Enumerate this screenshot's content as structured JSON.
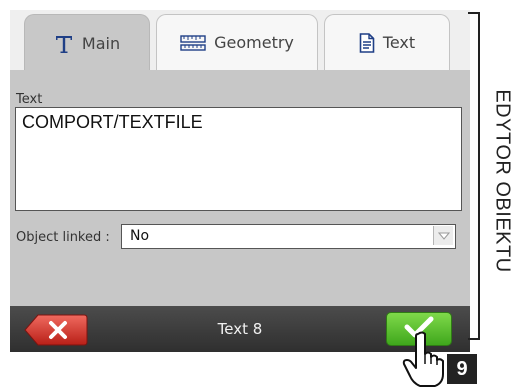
{
  "tabs": [
    {
      "label": "Main",
      "icon": "text-t-icon",
      "active": true
    },
    {
      "label": "Geometry",
      "icon": "ruler-icon",
      "active": false
    },
    {
      "label": "Text",
      "icon": "document-icon",
      "active": false
    }
  ],
  "text_field": {
    "label": "Text",
    "value": "COMPORT/TEXTFILE"
  },
  "object_linked": {
    "label": "Object linked :",
    "value": "No"
  },
  "footer": {
    "title": "Text 8",
    "cancel_icon": "close-icon",
    "ok_icon": "checkmark-icon"
  },
  "side_title": "EDYTOR OBIEKTU",
  "badge": "9",
  "colors": {
    "ok_green": "#4cbc24",
    "cancel_red": "#d9342b",
    "tab_active": "#c8c8c8",
    "content_bg": "#c7c7c7"
  }
}
